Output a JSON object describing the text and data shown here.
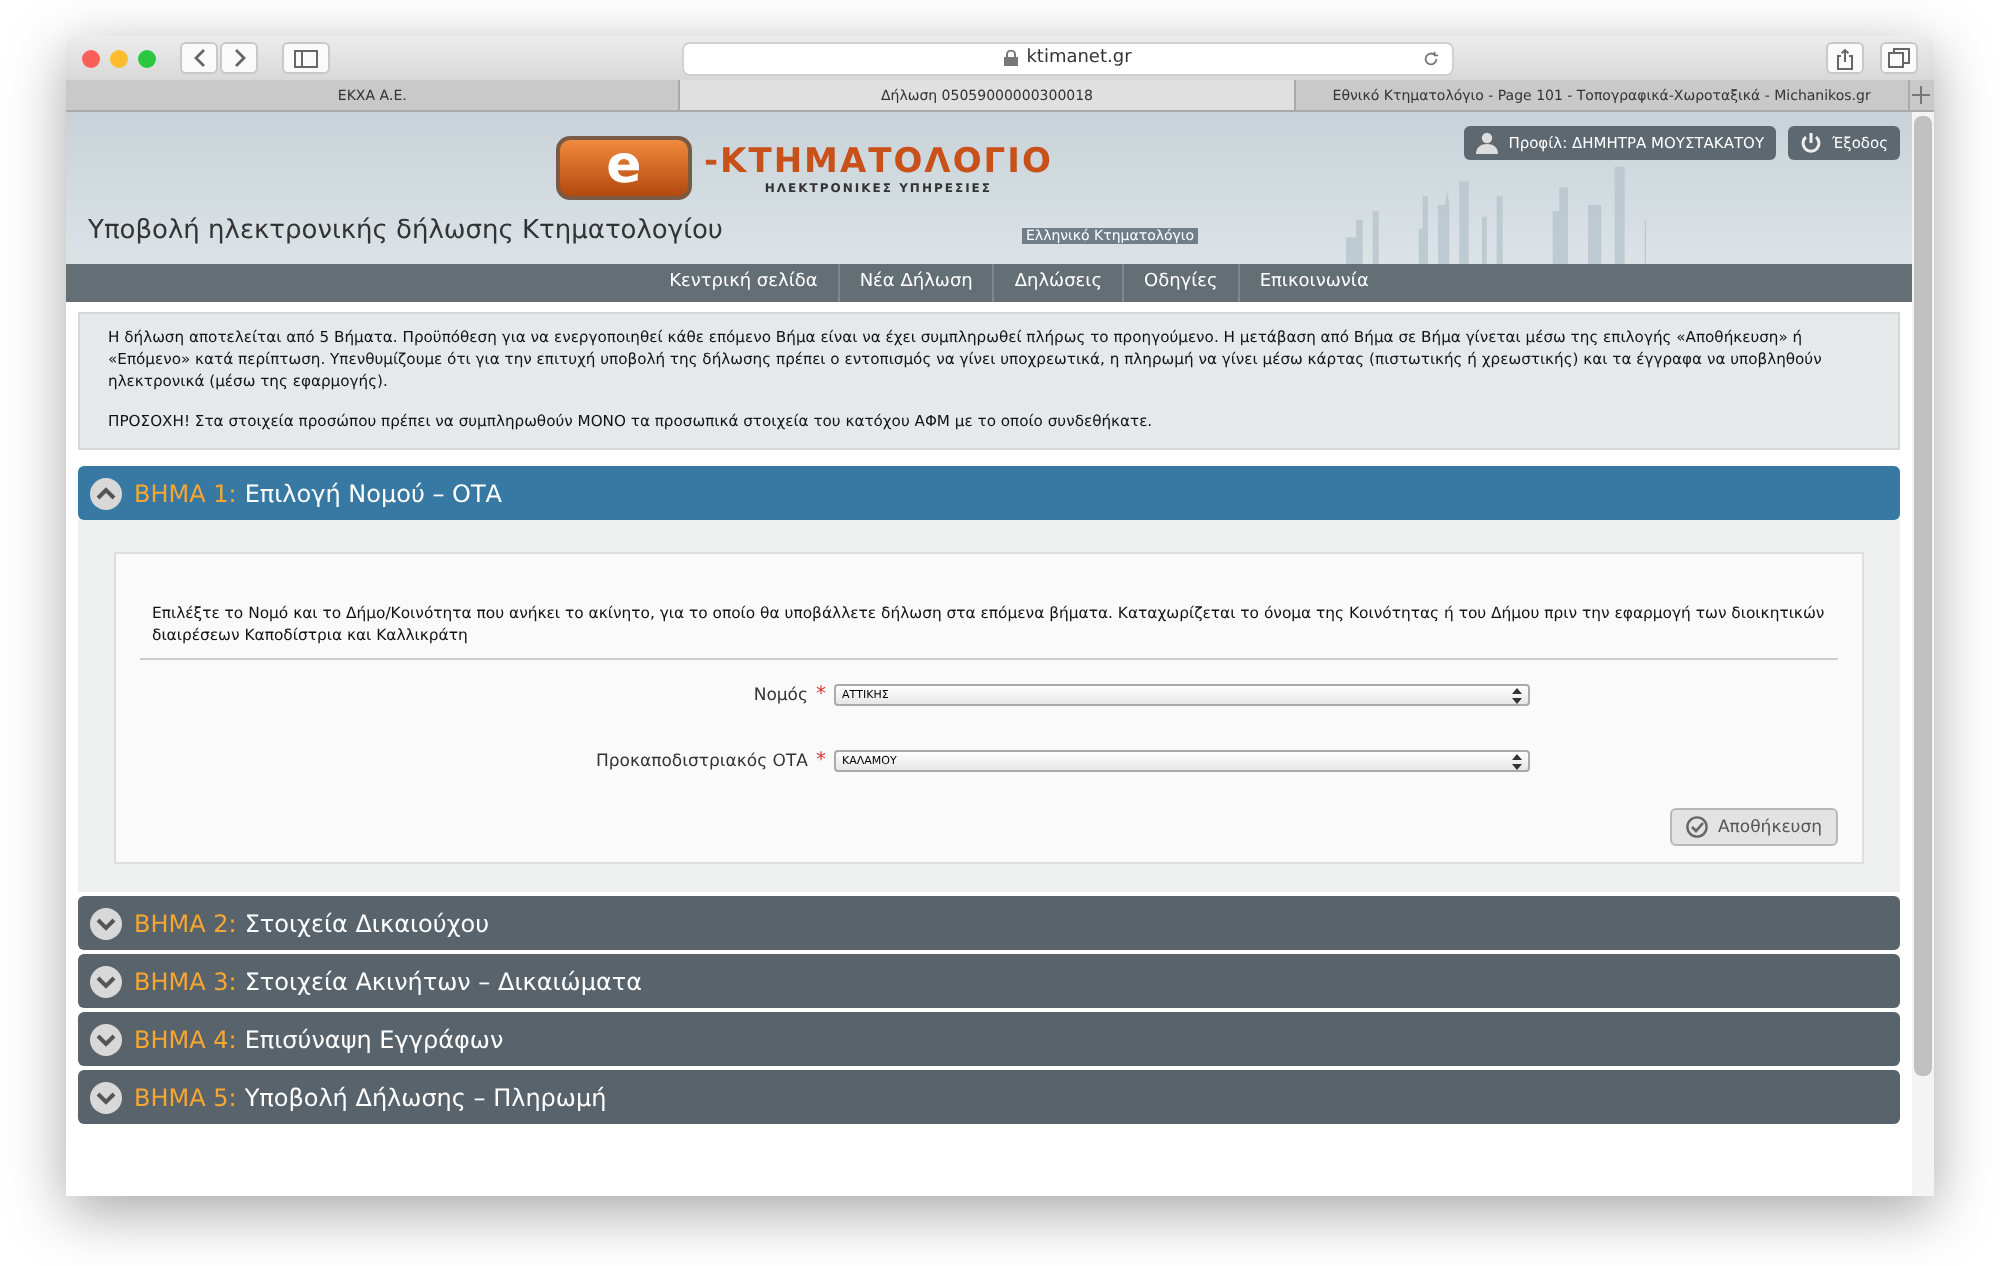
{
  "browser": {
    "url": "ktimanet.gr",
    "tabs": [
      {
        "label": "ΕΚΧΑ Α.Ε.",
        "selected": false
      },
      {
        "label": "Δήλωση 05059000000300018",
        "selected": true
      },
      {
        "label": "Εθνικό Κτηματολόγιο - Page 101 - Τοπογραφικά-Χωροταξικά - Michanikos.gr",
        "selected": false
      }
    ]
  },
  "header": {
    "logo_letter": "e",
    "logo_title": "-ΚΤΗΜΑΤΟΛΟΓΙΟ",
    "logo_subtitle": "ΗΛΕΚΤΡΟΝΙΚΕΣ ΥΠΗΡΕΣΙΕΣ",
    "emblem_text": "Ελληνικό Κτηματολόγιο",
    "site_title": "Υποβολή ηλεκτρονικής δήλωσης Κτηματολογίου",
    "profile_button": "Προφίλ: ΔΗΜΗΤΡΑ ΜΟΥΣΤΑΚΑΤΟΥ",
    "logout_button": "Έξοδος"
  },
  "nav": [
    "Κεντρική σελίδα",
    "Νέα Δήλωση",
    "Δηλώσεις",
    "Οδηγίες",
    "Επικοινωνία"
  ],
  "notice": [
    "Η δήλωση αποτελείται από 5 Βήματα. Προϋπόθεση για να ενεργοποιηθεί κάθε επόμενο Βήμα είναι να έχει συμπληρωθεί πλήρως το προηγούμενο. Η μετάβαση από Βήμα σε Βήμα γίνεται μέσω της επιλογής «Αποθήκευση» ή «Επόμενο» κατά περίπτωση. Υπενθυμίζουμε ότι για την επιτυχή υποβολή της δήλωσης πρέπει ο εντοπισμός να γίνει υποχρεωτικά, η πληρωμή να γίνει μέσω κάρτας (πιστωτικής ή χρεωστικής) και τα έγγραφα να υποβληθούν ηλεκτρονικά (μέσω της εφαρμογής).",
    "ΠΡΟΣΟΧΗ! Στα στοιχεία προσώπου πρέπει να συμπληρωθούν ΜΟΝΟ τα προσωπικά στοιχεία του κατόχου ΑΦΜ με το οποίο συνδεθήκατε."
  ],
  "steps": [
    {
      "label": "ΒΗΜΑ 1:",
      "title": "Επιλογή Νομού – ΟΤΑ",
      "expanded": true
    },
    {
      "label": "ΒΗΜΑ 2:",
      "title": "Στοιχεία Δικαιούχου",
      "expanded": false
    },
    {
      "label": "ΒΗΜΑ 3:",
      "title": "Στοιχεία Ακινήτων – Δικαιώματα",
      "expanded": false
    },
    {
      "label": "ΒΗΜΑ 4:",
      "title": "Επισύναψη Εγγράφων",
      "expanded": false
    },
    {
      "label": "ΒΗΜΑ 5:",
      "title": "Υποβολή Δήλωσης – Πληρωμή",
      "expanded": false
    }
  ],
  "form": {
    "intro": "Επιλέξτε το Νομό και το Δήμο/Κοινότητα που ανήκει το ακίνητο, για το οποίο θα υποβάλλετε δήλωση στα επόμενα βήματα. Καταχωρίζεται το όνομα της Κοινότητας ή του Δήμου πριν την εφαρμογή των διοικητικών διαιρέσεων Καποδίστρια και Καλλικράτη",
    "fields": [
      {
        "label": "Νομός",
        "required_mark": "*",
        "value": "ΑΤΤΙΚΗΣ"
      },
      {
        "label": "Προκαποδιστριακός ΟΤΑ",
        "required_mark": "*",
        "value": "ΚΑΛΑΜΟΥ"
      }
    ],
    "save_button": "Αποθήκευση"
  }
}
